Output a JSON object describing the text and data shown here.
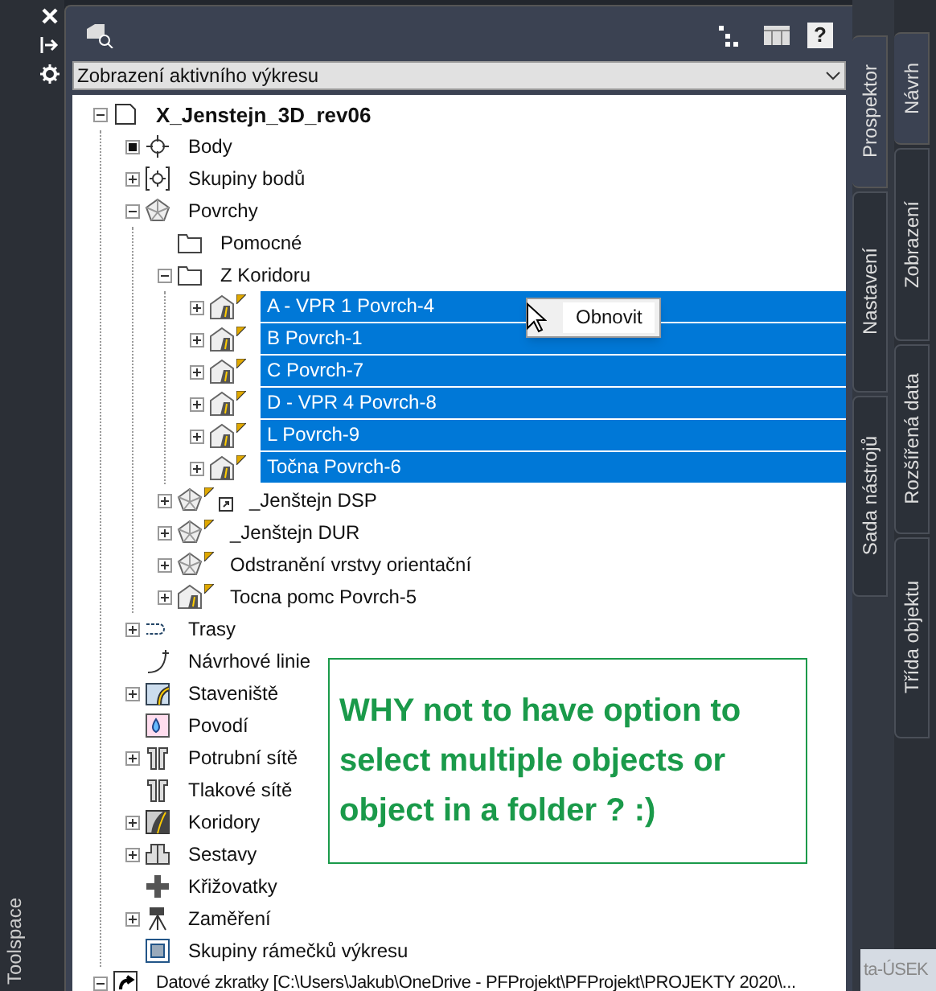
{
  "palette": {
    "title": "Toolspace"
  },
  "toolbar": {
    "help_label": "?"
  },
  "dropdown": {
    "value": "Zobrazení aktivního výkresu"
  },
  "tree": [
    {
      "label": "X_Jenstejn_3D_rev06",
      "kind": "drawing",
      "expandable": true,
      "expanded": true,
      "bold": true,
      "selected": false,
      "children": [
        {
          "label": "Body",
          "kind": "point",
          "expandable": true,
          "filled": true,
          "selected": false
        },
        {
          "label": "Skupiny bodů",
          "kind": "point-group",
          "expandable": true,
          "expanded": false,
          "selected": false
        },
        {
          "label": "Povrchy",
          "kind": "surface",
          "expandable": true,
          "expanded": true,
          "selected": false,
          "children": [
            {
              "label": "Pomocné",
              "kind": "folder",
              "expandable": false,
              "selected": false
            },
            {
              "label": "Z Koridoru",
              "kind": "folder",
              "expandable": true,
              "expanded": true,
              "selected": false,
              "children": [
                {
                  "label": "A - VPR 1 Povrch-4",
                  "kind": "corridor-surface",
                  "expandable": true,
                  "expanded": false,
                  "flag": true,
                  "selected": true
                },
                {
                  "label": "B Povrch-1",
                  "kind": "corridor-surface",
                  "expandable": true,
                  "expanded": false,
                  "flag": true,
                  "selected": true
                },
                {
                  "label": "C Povrch-7",
                  "kind": "corridor-surface",
                  "expandable": true,
                  "expanded": false,
                  "flag": true,
                  "selected": true
                },
                {
                  "label": "D - VPR 4 Povrch-8",
                  "kind": "corridor-surface",
                  "expandable": true,
                  "expanded": false,
                  "flag": true,
                  "selected": true
                },
                {
                  "label": "L Povrch-9",
                  "kind": "corridor-surface",
                  "expandable": true,
                  "expanded": false,
                  "flag": true,
                  "selected": true
                },
                {
                  "label": "Točna Povrch-6",
                  "kind": "corridor-surface",
                  "expandable": true,
                  "expanded": false,
                  "flag": true,
                  "selected": true
                }
              ]
            },
            {
              "label": "_Jenštejn DSP",
              "kind": "surface",
              "expandable": true,
              "expanded": false,
              "flag": true,
              "reference": true,
              "selected": false
            },
            {
              "label": "_Jenštejn DUR",
              "kind": "surface",
              "expandable": true,
              "expanded": false,
              "flag": true,
              "selected": false
            },
            {
              "label": "Odstranění vrstvy orientační",
              "kind": "surface",
              "expandable": true,
              "expanded": false,
              "flag": true,
              "selected": false
            },
            {
              "label": "Tocna pomc Povrch-5",
              "kind": "corridor-surface",
              "expandable": true,
              "expanded": false,
              "flag": true,
              "selected": false
            }
          ]
        },
        {
          "label": "Trasy",
          "kind": "alignment",
          "expandable": true,
          "expanded": false,
          "selected": false
        },
        {
          "label": "Návrhové linie",
          "kind": "feature-line",
          "expandable": false,
          "selected": false
        },
        {
          "label": "Staveniště",
          "kind": "site",
          "expandable": true,
          "expanded": false,
          "selected": false
        },
        {
          "label": "Povodí",
          "kind": "catchment",
          "expandable": false,
          "selected": false
        },
        {
          "label": "Potrubní sítě",
          "kind": "pipe",
          "expandable": true,
          "expanded": false,
          "selected": false
        },
        {
          "label": "Tlakové sítě",
          "kind": "pipe",
          "expandable": false,
          "selected": false
        },
        {
          "label": "Koridory",
          "kind": "corridor",
          "expandable": true,
          "expanded": false,
          "selected": false
        },
        {
          "label": "Sestavy",
          "kind": "assembly",
          "expandable": true,
          "expanded": false,
          "selected": false
        },
        {
          "label": "Křižovatky",
          "kind": "intersection",
          "expandable": false,
          "selected": false
        },
        {
          "label": "Zaměření",
          "kind": "survey",
          "expandable": true,
          "expanded": false,
          "selected": false
        },
        {
          "label": "Skupiny rámečků výkresu",
          "kind": "view-frame",
          "expandable": false,
          "selected": false
        }
      ]
    },
    {
      "label": "Datové zkratky [C:\\Users\\Jakub\\OneDrive - PFProjekt\\PFProjekt\\PROJEKTY 2020\\...",
      "kind": "shortcut",
      "expandable": true,
      "expanded": true,
      "small": true,
      "selected": false
    }
  ],
  "context_menu": {
    "items": [
      "Obnovit"
    ]
  },
  "note": {
    "text": "WHY not to have option to select multiple objects or object in a folder ? :)"
  },
  "tabs_inner": [
    {
      "label": "Prospektor",
      "selected": true
    },
    {
      "label": "Nastavení",
      "selected": false
    },
    {
      "label": "Sada nástrojů",
      "selected": false
    }
  ],
  "tabs_outer": [
    {
      "label": "Návrh",
      "selected": true
    },
    {
      "label": "Zobrazení",
      "selected": false
    },
    {
      "label": "Rozšířená data",
      "selected": false
    },
    {
      "label": "Třída objektu",
      "selected": false
    }
  ],
  "background_tab": {
    "label": "ta-ÚSEK"
  }
}
